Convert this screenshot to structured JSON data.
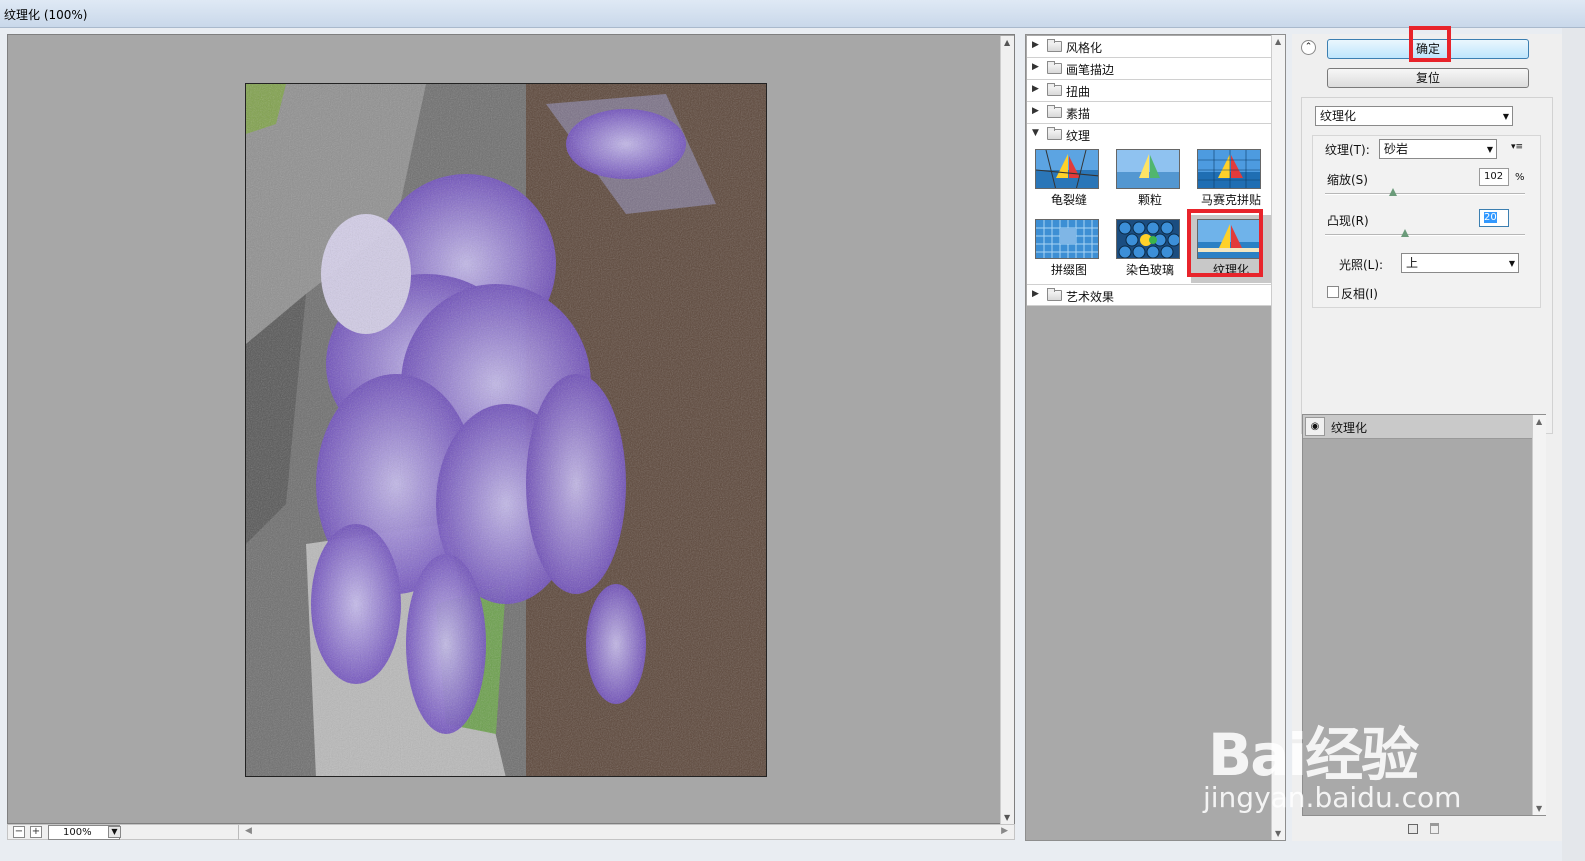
{
  "window": {
    "title": "纹理化 (100%)"
  },
  "preview": {
    "zoom": "100%",
    "zoom_out": "−",
    "zoom_in": "+"
  },
  "gallery": {
    "categories_top": [
      "风格化",
      "画笔描边",
      "扭曲",
      "素描"
    ],
    "open_category": "纹理",
    "filters": [
      "龟裂缝",
      "颗粒",
      "马赛克拼贴",
      "拼缀图",
      "染色玻璃",
      "纹理化"
    ],
    "selected_filter": "纹理化",
    "categories_bottom": [
      "艺术效果"
    ]
  },
  "buttons": {
    "ok": "确定",
    "reset": "复位"
  },
  "settings": {
    "filter_select": "纹理化",
    "texture_label": "纹理(T):",
    "texture_value": "砂岩",
    "scale_label": "缩放(S)",
    "scale_value": "102",
    "scale_unit": "%",
    "scale_fraction": 0.34,
    "relief_label": "凸现(R)",
    "relief_value": "20",
    "relief_fraction": 0.4,
    "light_label": "光照(L):",
    "light_value": "上",
    "invert_label": "反相(I)",
    "invert_checked": false
  },
  "layers": {
    "items": [
      "纹理化"
    ]
  },
  "watermark": {
    "logo": "Bai经验",
    "url": "jingyan.baidu.com"
  }
}
